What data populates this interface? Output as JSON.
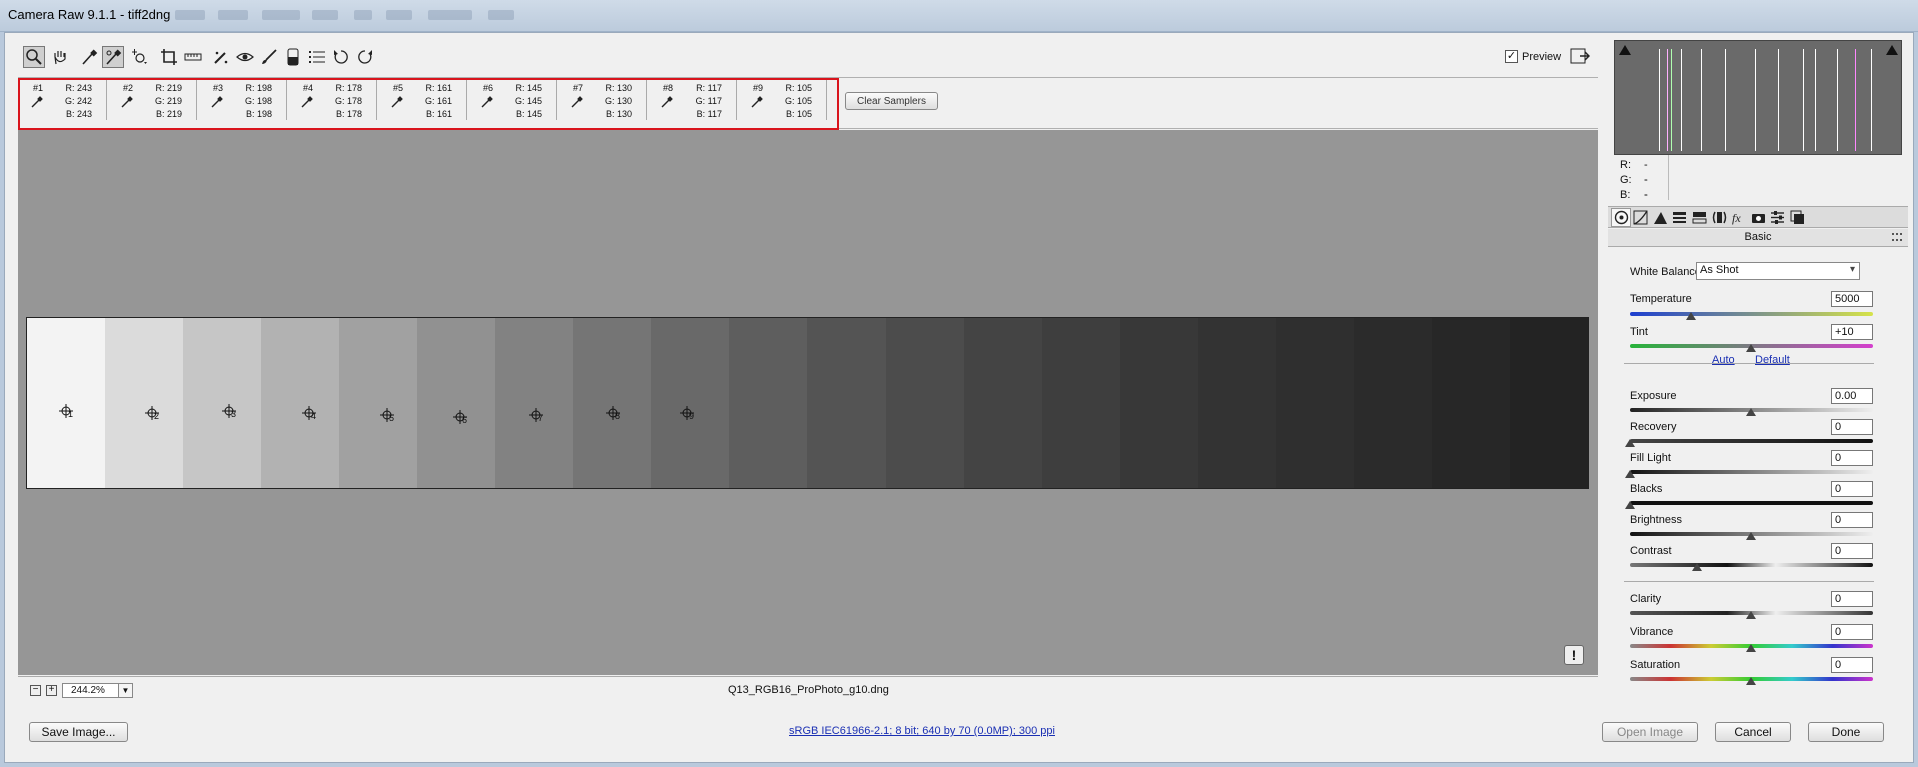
{
  "window": {
    "title": "Camera Raw 9.1.1  -  tiff2dng"
  },
  "toolbar": {
    "tools": [
      "zoom-tool-icon",
      "hand-tool-icon",
      "white-balance-tool-icon",
      "color-sampler-tool-icon",
      "targeted-adjustment-icon",
      "crop-tool-icon",
      "straighten-tool-icon",
      "spot-removal-icon",
      "red-eye-icon",
      "adjustment-brush-icon",
      "graduated-filter-icon",
      "preferences-icon",
      "rotate-ccw-icon",
      "rotate-cw-icon"
    ],
    "preview_label": "Preview",
    "preview_checked": "✓"
  },
  "samplers": {
    "items": [
      {
        "num": "#1",
        "r": "R: 243",
        "g": "G: 242",
        "b": "B: 243"
      },
      {
        "num": "#2",
        "r": "R: 219",
        "g": "G: 219",
        "b": "B: 219"
      },
      {
        "num": "#3",
        "r": "R: 198",
        "g": "G: 198",
        "b": "B: 198"
      },
      {
        "num": "#4",
        "r": "R: 178",
        "g": "G: 178",
        "b": "B: 178"
      },
      {
        "num": "#5",
        "r": "R: 161",
        "g": "G: 161",
        "b": "B: 161"
      },
      {
        "num": "#6",
        "r": "R: 145",
        "g": "G: 145",
        "b": "B: 145"
      },
      {
        "num": "#7",
        "r": "R: 130",
        "g": "G: 130",
        "b": "B: 130"
      },
      {
        "num": "#8",
        "r": "R: 117",
        "g": "G: 117",
        "b": "B: 117"
      },
      {
        "num": "#9",
        "r": "R: 105",
        "g": "G: 105",
        "b": "B: 105"
      }
    ],
    "clear_label": "Clear Samplers"
  },
  "image": {
    "patch_colors": [
      "#f3f3f3",
      "#dbdbdb",
      "#c6c6c6",
      "#b2b2b2",
      "#a1a1a1",
      "#919191",
      "#828282",
      "#757575",
      "#696969",
      "#5e5e5e",
      "#545454",
      "#4c4c4c",
      "#444444",
      "#3e3e3e",
      "#383838",
      "#333333",
      "#2f2f2f",
      "#2b2b2b",
      "#272727",
      "#232323"
    ],
    "target_labels": [
      "1",
      "2",
      "3",
      "4",
      "5",
      "6",
      "7",
      "8",
      "9"
    ]
  },
  "status": {
    "zoom_out": "−",
    "zoom_in": "+",
    "zoom_value": "244.2%",
    "filename": "Q13_RGB16_ProPhoto_g10.dng"
  },
  "histogram": {
    "r_label": "R:",
    "g_label": "G:",
    "b_label": "B:",
    "r_value": "---",
    "g_value": "---",
    "b_value": "---"
  },
  "panel": {
    "tabs": [
      "basic-tab-icon",
      "tone-curve-tab-icon",
      "detail-tab-icon",
      "hsl-tab-icon",
      "split-toning-tab-icon",
      "lens-corrections-tab-icon",
      "effects-tab-icon",
      "camera-calibration-tab-icon",
      "presets-tab-icon",
      "snapshots-tab-icon"
    ],
    "title": "Basic",
    "white_balance_label": "White Balance:",
    "white_balance_value": "As Shot",
    "auto_label": "Auto",
    "default_label": "Default",
    "sliders": {
      "temperature": {
        "label": "Temperature",
        "value": "5000"
      },
      "tint": {
        "label": "Tint",
        "value": "+10"
      },
      "exposure": {
        "label": "Exposure",
        "value": "0.00"
      },
      "recovery": {
        "label": "Recovery",
        "value": "0"
      },
      "fill_light": {
        "label": "Fill Light",
        "value": "0"
      },
      "blacks": {
        "label": "Blacks",
        "value": "0"
      },
      "brightness": {
        "label": "Brightness",
        "value": "0"
      },
      "contrast": {
        "label": "Contrast",
        "value": "0"
      },
      "clarity": {
        "label": "Clarity",
        "value": "0"
      },
      "vibrance": {
        "label": "Vibrance",
        "value": "0"
      },
      "saturation": {
        "label": "Saturation",
        "value": "0"
      }
    }
  },
  "footer": {
    "save_image": "Save Image...",
    "workflow_info": "sRGB IEC61966-2.1; 8 bit; 640 by 70 (0.0MP); 300 ppi",
    "open_image": "Open Image",
    "cancel": "Cancel",
    "done": "Done"
  }
}
